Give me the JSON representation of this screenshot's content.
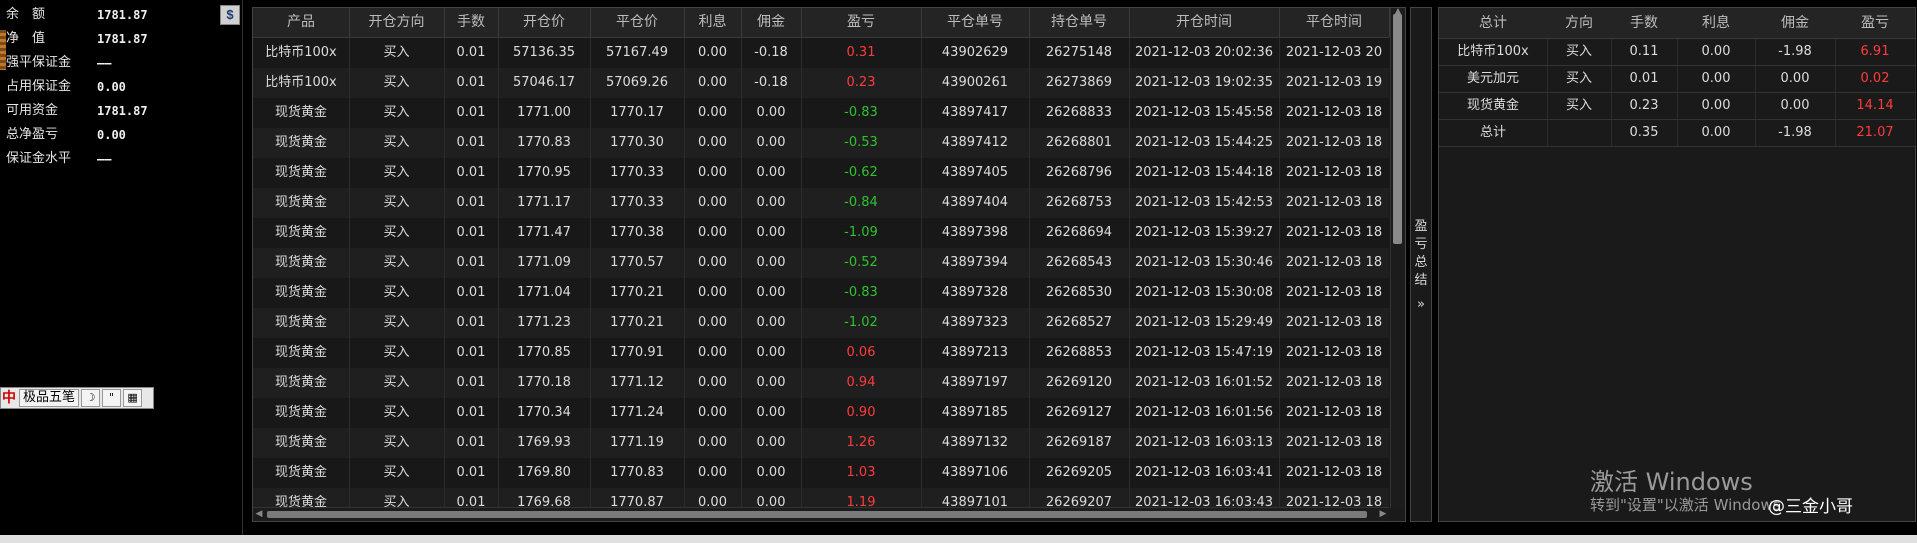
{
  "account": {
    "rows": [
      {
        "label": "余　额",
        "value": "1781.87"
      },
      {
        "label": "净　值",
        "value": "1781.87"
      },
      {
        "label": "强平保证金",
        "value": "——"
      },
      {
        "label": "占用保证金",
        "value": "0.00"
      },
      {
        "label": "可用资金",
        "value": "1781.87"
      },
      {
        "label": "总净盈亏",
        "value": "0.00"
      },
      {
        "label": "保证金水平",
        "value": "——"
      }
    ],
    "dollar_button": "$"
  },
  "ime_bar": {
    "logo": "中",
    "label": "极品五笔",
    "moon": "☽",
    "punct": "\"",
    "keyboard": "▦"
  },
  "orders": {
    "headers": [
      "产品",
      "开仓方向",
      "手数",
      "开仓价",
      "平仓价",
      "利息",
      "佣金",
      "盈亏",
      "平仓单号",
      "持仓单号",
      "开仓时间",
      "平仓时间"
    ],
    "rows": [
      {
        "product": "比特币100x",
        "side": "买入",
        "lots": "0.01",
        "open": "57136.35",
        "close": "57167.49",
        "interest": "0.00",
        "commission": "-0.18",
        "pnl": "0.31",
        "pnl_dir": "up",
        "close_no": "43902629",
        "pos_no": "26275148",
        "open_time": "2021-12-03 20:02:36",
        "close_time": "2021-12-03 20"
      },
      {
        "product": "比特币100x",
        "side": "买入",
        "lots": "0.01",
        "open": "57046.17",
        "close": "57069.26",
        "interest": "0.00",
        "commission": "-0.18",
        "pnl": "0.23",
        "pnl_dir": "up",
        "close_no": "43900261",
        "pos_no": "26273869",
        "open_time": "2021-12-03 19:02:35",
        "close_time": "2021-12-03 19"
      },
      {
        "product": "现货黄金",
        "side": "买入",
        "lots": "0.01",
        "open": "1771.00",
        "close": "1770.17",
        "interest": "0.00",
        "commission": "0.00",
        "pnl": "-0.83",
        "pnl_dir": "down",
        "close_no": "43897417",
        "pos_no": "26268833",
        "open_time": "2021-12-03 15:45:58",
        "close_time": "2021-12-03 18"
      },
      {
        "product": "现货黄金",
        "side": "买入",
        "lots": "0.01",
        "open": "1770.83",
        "close": "1770.30",
        "interest": "0.00",
        "commission": "0.00",
        "pnl": "-0.53",
        "pnl_dir": "down",
        "close_no": "43897412",
        "pos_no": "26268801",
        "open_time": "2021-12-03 15:44:25",
        "close_time": "2021-12-03 18"
      },
      {
        "product": "现货黄金",
        "side": "买入",
        "lots": "0.01",
        "open": "1770.95",
        "close": "1770.33",
        "interest": "0.00",
        "commission": "0.00",
        "pnl": "-0.62",
        "pnl_dir": "down",
        "close_no": "43897405",
        "pos_no": "26268796",
        "open_time": "2021-12-03 15:44:18",
        "close_time": "2021-12-03 18"
      },
      {
        "product": "现货黄金",
        "side": "买入",
        "lots": "0.01",
        "open": "1771.17",
        "close": "1770.33",
        "interest": "0.00",
        "commission": "0.00",
        "pnl": "-0.84",
        "pnl_dir": "down",
        "close_no": "43897404",
        "pos_no": "26268753",
        "open_time": "2021-12-03 15:42:53",
        "close_time": "2021-12-03 18"
      },
      {
        "product": "现货黄金",
        "side": "买入",
        "lots": "0.01",
        "open": "1771.47",
        "close": "1770.38",
        "interest": "0.00",
        "commission": "0.00",
        "pnl": "-1.09",
        "pnl_dir": "down",
        "close_no": "43897398",
        "pos_no": "26268694",
        "open_time": "2021-12-03 15:39:27",
        "close_time": "2021-12-03 18"
      },
      {
        "product": "现货黄金",
        "side": "买入",
        "lots": "0.01",
        "open": "1771.09",
        "close": "1770.57",
        "interest": "0.00",
        "commission": "0.00",
        "pnl": "-0.52",
        "pnl_dir": "down",
        "close_no": "43897394",
        "pos_no": "26268543",
        "open_time": "2021-12-03 15:30:46",
        "close_time": "2021-12-03 18"
      },
      {
        "product": "现货黄金",
        "side": "买入",
        "lots": "0.01",
        "open": "1771.04",
        "close": "1770.21",
        "interest": "0.00",
        "commission": "0.00",
        "pnl": "-0.83",
        "pnl_dir": "down",
        "close_no": "43897328",
        "pos_no": "26268530",
        "open_time": "2021-12-03 15:30:08",
        "close_time": "2021-12-03 18"
      },
      {
        "product": "现货黄金",
        "side": "买入",
        "lots": "0.01",
        "open": "1771.23",
        "close": "1770.21",
        "interest": "0.00",
        "commission": "0.00",
        "pnl": "-1.02",
        "pnl_dir": "down",
        "close_no": "43897323",
        "pos_no": "26268527",
        "open_time": "2021-12-03 15:29:49",
        "close_time": "2021-12-03 18"
      },
      {
        "product": "现货黄金",
        "side": "买入",
        "lots": "0.01",
        "open": "1770.85",
        "close": "1770.91",
        "interest": "0.00",
        "commission": "0.00",
        "pnl": "0.06",
        "pnl_dir": "up",
        "close_no": "43897213",
        "pos_no": "26268853",
        "open_time": "2021-12-03 15:47:19",
        "close_time": "2021-12-03 18"
      },
      {
        "product": "现货黄金",
        "side": "买入",
        "lots": "0.01",
        "open": "1770.18",
        "close": "1771.12",
        "interest": "0.00",
        "commission": "0.00",
        "pnl": "0.94",
        "pnl_dir": "up",
        "close_no": "43897197",
        "pos_no": "26269120",
        "open_time": "2021-12-03 16:01:52",
        "close_time": "2021-12-03 18"
      },
      {
        "product": "现货黄金",
        "side": "买入",
        "lots": "0.01",
        "open": "1770.34",
        "close": "1771.24",
        "interest": "0.00",
        "commission": "0.00",
        "pnl": "0.90",
        "pnl_dir": "up",
        "close_no": "43897185",
        "pos_no": "26269127",
        "open_time": "2021-12-03 16:01:56",
        "close_time": "2021-12-03 18"
      },
      {
        "product": "现货黄金",
        "side": "买入",
        "lots": "0.01",
        "open": "1769.93",
        "close": "1771.19",
        "interest": "0.00",
        "commission": "0.00",
        "pnl": "1.26",
        "pnl_dir": "up",
        "close_no": "43897132",
        "pos_no": "26269187",
        "open_time": "2021-12-03 16:03:13",
        "close_time": "2021-12-03 18"
      },
      {
        "product": "现货黄金",
        "side": "买入",
        "lots": "0.01",
        "open": "1769.80",
        "close": "1770.83",
        "interest": "0.00",
        "commission": "0.00",
        "pnl": "1.03",
        "pnl_dir": "up",
        "close_no": "43897106",
        "pos_no": "26269205",
        "open_time": "2021-12-03 16:03:41",
        "close_time": "2021-12-03 18"
      },
      {
        "product": "现货黄金",
        "side": "买入",
        "lots": "0.01",
        "open": "1769.68",
        "close": "1770.87",
        "interest": "0.00",
        "commission": "0.00",
        "pnl": "1.19",
        "pnl_dir": "up",
        "close_no": "43897101",
        "pos_no": "26269207",
        "open_time": "2021-12-03 16:03:43",
        "close_time": "2021-12-03 18"
      }
    ]
  },
  "summary_tab": {
    "label": "盈亏总结",
    "arrow": "»"
  },
  "summary": {
    "headers": [
      "总计",
      "方向",
      "手数",
      "利息",
      "佣金",
      "盈亏"
    ],
    "rows": [
      {
        "product": "比特币100x",
        "side": "买入",
        "lots": "0.11",
        "interest": "0.00",
        "commission": "-1.98",
        "pnl": "6.91"
      },
      {
        "product": "美元加元",
        "side": "买入",
        "lots": "0.01",
        "interest": "0.00",
        "commission": "0.00",
        "pnl": "0.02"
      },
      {
        "product": "现货黄金",
        "side": "买入",
        "lots": "0.23",
        "interest": "0.00",
        "commission": "0.00",
        "pnl": "14.14"
      },
      {
        "product": "总计",
        "side": "",
        "lots": "0.35",
        "interest": "0.00",
        "commission": "-1.98",
        "pnl": "21.07"
      }
    ]
  },
  "watermarks": {
    "win_line1": "激活 Windows",
    "win_line2": "转到\"设置\"以激活 Windows",
    "creator": "@三金小哥"
  },
  "colors": {
    "profit": "#ff3b3b",
    "loss": "#2ec22e",
    "background": "#000000",
    "panel": "#1a1a1a"
  }
}
